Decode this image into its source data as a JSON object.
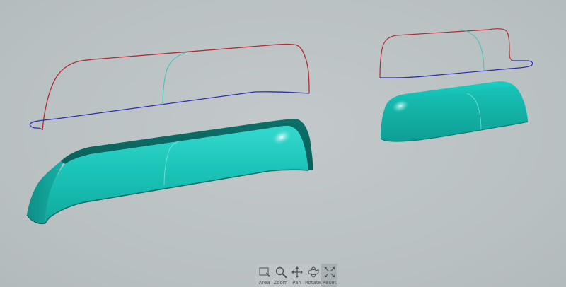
{
  "toolbar": {
    "tools": [
      {
        "name": "area",
        "label": "Area",
        "icon": "area-select-icon"
      },
      {
        "name": "zoom",
        "label": "Zoom",
        "icon": "magnifier-icon"
      },
      {
        "name": "pan",
        "label": "Pan",
        "icon": "four-arrows-icon"
      },
      {
        "name": "rotate",
        "label": "Rotate",
        "icon": "rotate-orbit-icon"
      },
      {
        "name": "reset",
        "label": "Reset",
        "icon": "expand-arrows-icon"
      }
    ],
    "active": "reset"
  },
  "colors": {
    "background": "#bcc3c5",
    "solid": "#15bdb0",
    "solid_dark": "#0b7d76",
    "curve_red": "#b32b35",
    "curve_blue": "#2a2fae",
    "curve_cyan": "#3fc4bd"
  }
}
